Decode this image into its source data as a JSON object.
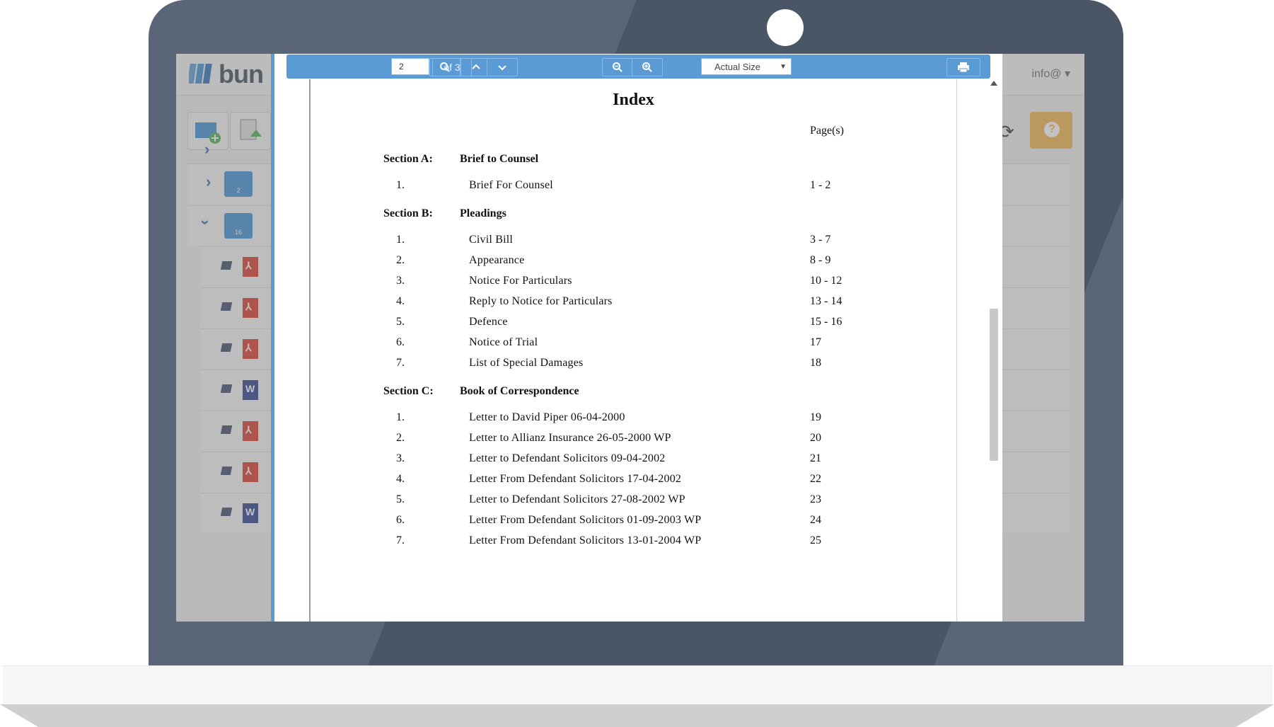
{
  "app": {
    "logo_text": "bun",
    "user_menu": "info@",
    "folders": [
      {
        "count": "2"
      },
      {
        "count": "16"
      }
    ],
    "file_types": [
      "pdf",
      "pdf",
      "pdf",
      "word",
      "pdf",
      "pdf",
      "word"
    ]
  },
  "viewer": {
    "toolbar": {
      "page_current": "2",
      "page_total": "of 3",
      "zoom": "Actual Size"
    },
    "document": {
      "title": "Index",
      "pages_header": "Page(s)",
      "sections": [
        {
          "label": "Section A:",
          "title": "Brief to Counsel",
          "items": [
            {
              "num": "1.",
              "text": "Brief For Counsel",
              "pages": "1 - 2"
            }
          ]
        },
        {
          "label": "Section B:",
          "title": "Pleadings",
          "items": [
            {
              "num": "1.",
              "text": "Civil Bill",
              "pages": "3 - 7"
            },
            {
              "num": "2.",
              "text": "Appearance",
              "pages": "8 - 9"
            },
            {
              "num": "3.",
              "text": "Notice For Particulars",
              "pages": "10 - 12"
            },
            {
              "num": "4.",
              "text": "Reply to Notice for Particulars",
              "pages": "13 - 14"
            },
            {
              "num": "5.",
              "text": "Defence",
              "pages": "15 - 16"
            },
            {
              "num": "6.",
              "text": "Notice of Trial",
              "pages": "17"
            },
            {
              "num": "7.",
              "text": "List of Special Damages",
              "pages": "18"
            }
          ]
        },
        {
          "label": "Section C:",
          "title": "Book of Correspondence",
          "items": [
            {
              "num": "1.",
              "text": "Letter to David Piper 06-04-2000",
              "pages": "19"
            },
            {
              "num": "2.",
              "text": "Letter to Allianz Insurance 26-05-2000 WP",
              "pages": "20"
            },
            {
              "num": "3.",
              "text": "Letter to Defendant Solicitors 09-04-2002",
              "pages": "21"
            },
            {
              "num": "4.",
              "text": "Letter From Defendant Solicitors 17-04-2002",
              "pages": "22"
            },
            {
              "num": "5.",
              "text": "Letter to Defendant Solicitors 27-08-2002 WP",
              "pages": "23"
            },
            {
              "num": "6.",
              "text": "Letter From Defendant Solicitors 01-09-2003 WP",
              "pages": "24"
            },
            {
              "num": "7.",
              "text": "Letter From Defendant Solicitors 13-01-2004 WP",
              "pages": "25"
            }
          ]
        }
      ]
    }
  }
}
